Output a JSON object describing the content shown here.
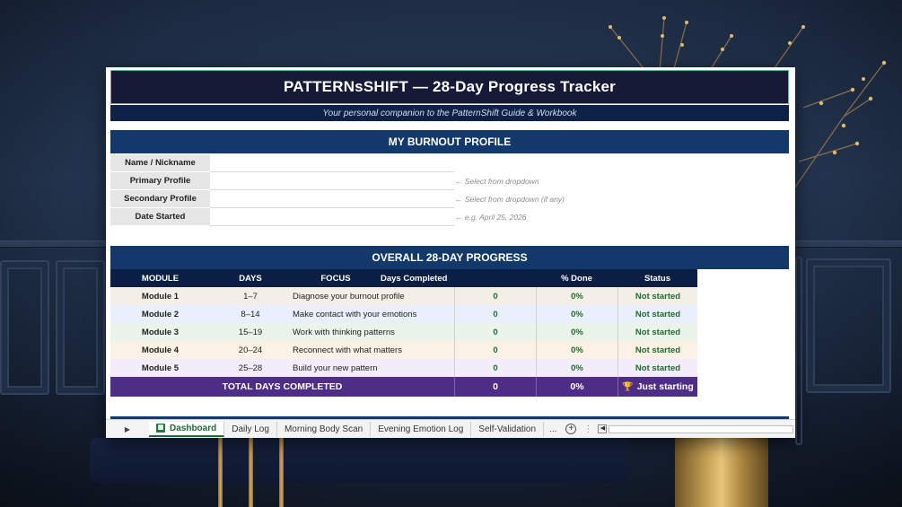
{
  "title": "PATTERNsSHIFT — 28-Day Progress Tracker",
  "subtitle": "Your personal companion to the PatternShift Guide & Workbook",
  "profile": {
    "heading": "MY BURNOUT PROFILE",
    "rows": [
      {
        "label": "Name / Nickname",
        "value": "",
        "hint": ""
      },
      {
        "label": "Primary Profile",
        "value": "",
        "hint": "← Select from dropdown"
      },
      {
        "label": "Secondary Profile",
        "value": "",
        "hint": "← Select from dropdown (if any)"
      },
      {
        "label": "Date Started",
        "value": "",
        "hint": "← e.g. April 25, 2026"
      }
    ]
  },
  "progress": {
    "heading": "OVERALL 28-DAY PROGRESS",
    "columns": {
      "module": "MODULE",
      "days": "DAYS",
      "focus": "FOCUS",
      "done": "Days Completed",
      "pct": "% Done",
      "status": "Status"
    },
    "rows": [
      {
        "module": "Module 1",
        "days": "1–7",
        "focus": "Diagnose your burnout profile",
        "done": "0",
        "pct": "0%",
        "status": "Not started",
        "bg": "#f4efe6"
      },
      {
        "module": "Module 2",
        "days": "8–14",
        "focus": "Make contact with your emotions",
        "done": "0",
        "pct": "0%",
        "status": "Not started",
        "bg": "#e9f0fb"
      },
      {
        "module": "Module 3",
        "days": "15–19",
        "focus": "Work with thinking patterns",
        "done": "0",
        "pct": "0%",
        "status": "Not started",
        "bg": "#eaf4ea"
      },
      {
        "module": "Module 4",
        "days": "20–24",
        "focus": "Reconnect with what matters",
        "done": "0",
        "pct": "0%",
        "status": "Not started",
        "bg": "#fbf1e4"
      },
      {
        "module": "Module 5",
        "days": "25–28",
        "focus": "Build your new pattern",
        "done": "0",
        "pct": "0%",
        "status": "Not started",
        "bg": "#f3ecfa"
      }
    ],
    "total": {
      "label": "TOTAL DAYS COMPLETED",
      "done": "0",
      "pct": "0%",
      "status": "Just starting",
      "status_icon": "trophy-icon"
    }
  },
  "tabs": {
    "items": [
      "Dashboard",
      "Daily Log",
      "Morning Body Scan",
      "Evening Emotion Log",
      "Self-Validation"
    ],
    "active": "Dashboard",
    "more": "...",
    "add": "+"
  },
  "colors": {
    "title_bg": "#171a36",
    "section_bg": "#13396b",
    "header_bg": "#0b1f45",
    "total_bg": "#4e2d86",
    "status_text": "#1f6b2e"
  }
}
